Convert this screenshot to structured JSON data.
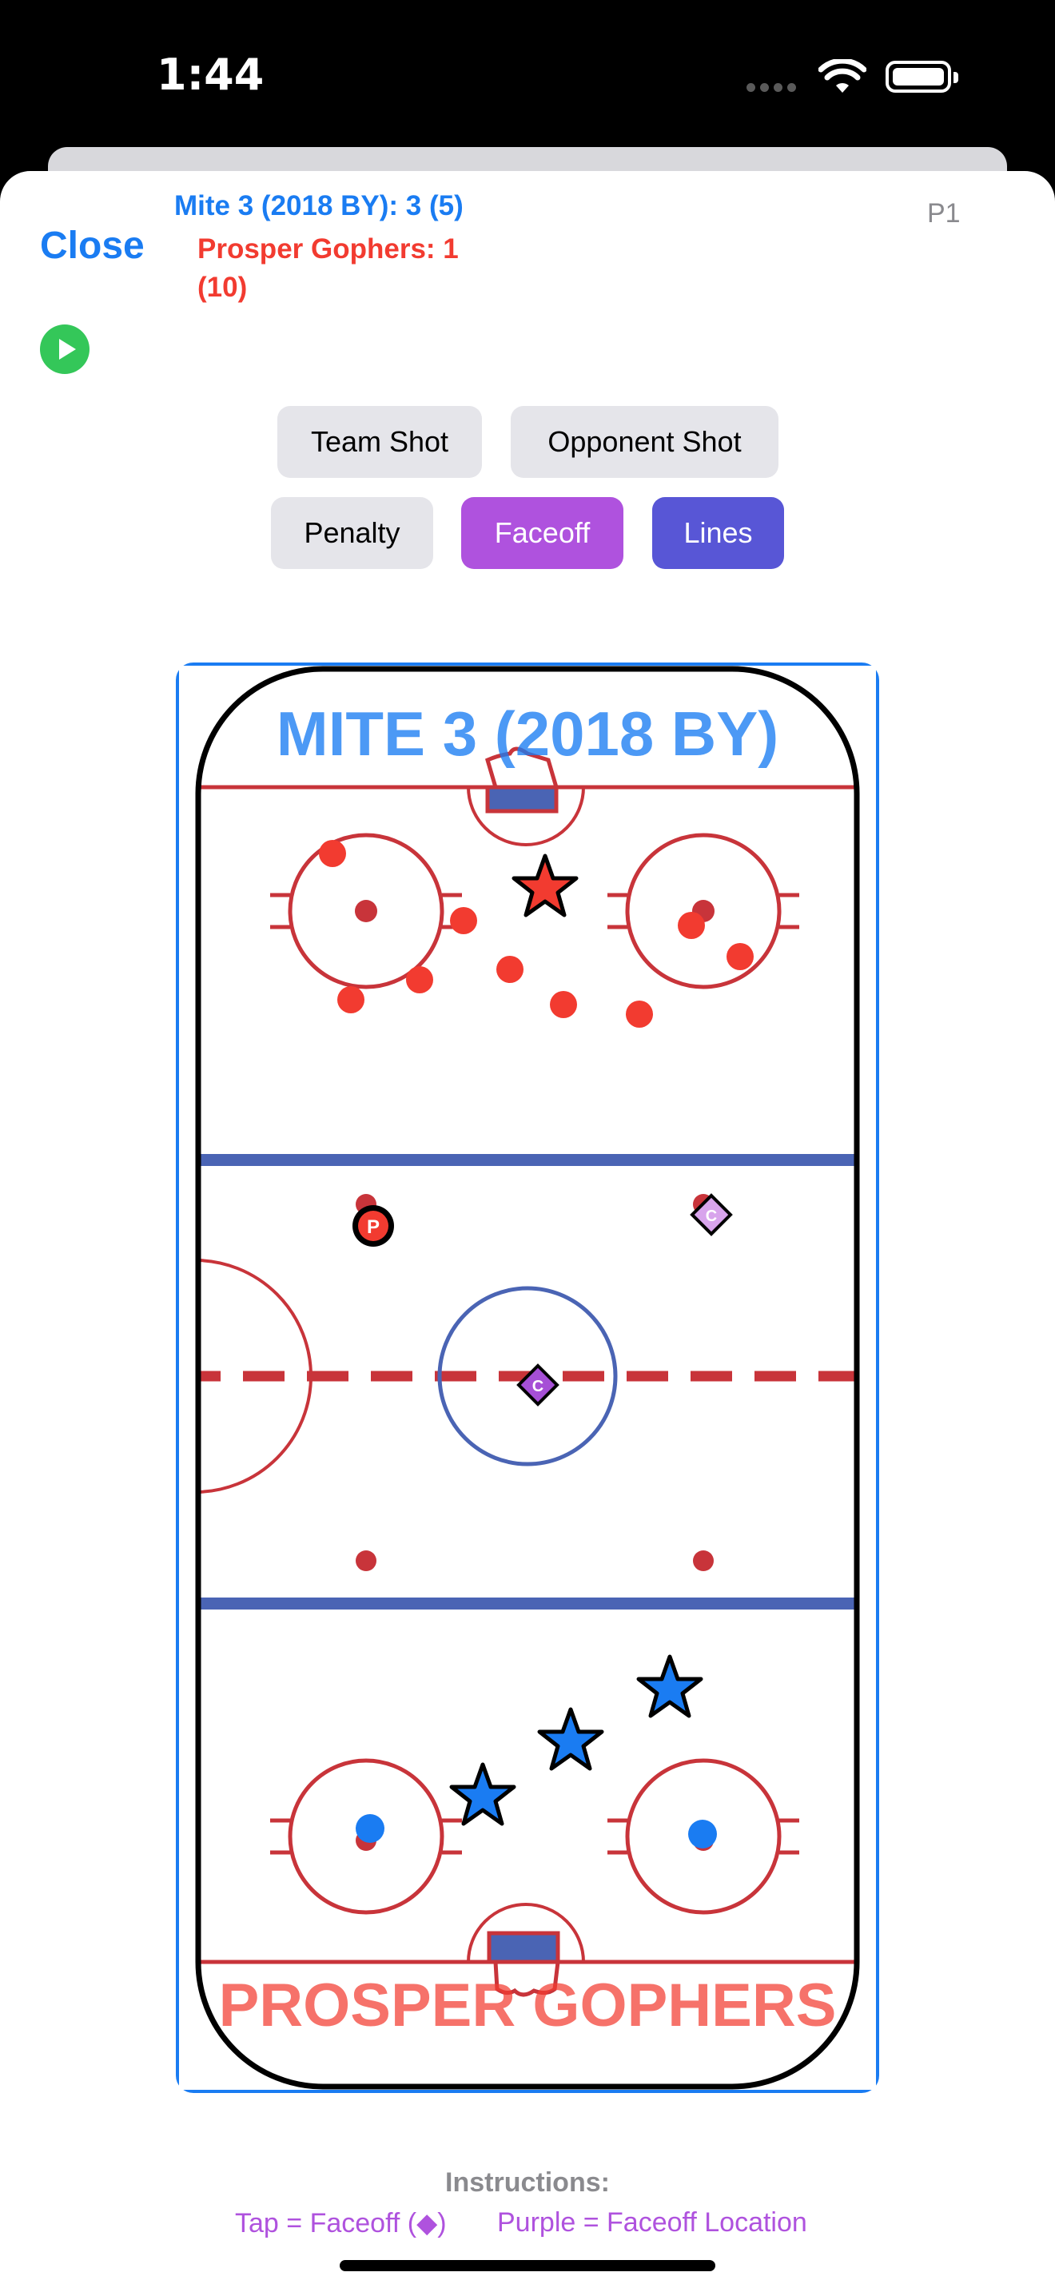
{
  "status_bar": {
    "time": "1:44"
  },
  "header": {
    "close_label": "Close",
    "team_score": "Mite 3 (2018 BY): 3 (5)",
    "opponent_score": "Prosper Gophers: 1 (10)",
    "period": "P1"
  },
  "actions": {
    "team_shot": "Team Shot",
    "opponent_shot": "Opponent Shot",
    "penalty": "Penalty",
    "faceoff": "Faceoff",
    "lines": "Lines"
  },
  "rink": {
    "team_name": "MITE 3 (2018 BY)",
    "opponent_name": "PROSPER GOPHERS",
    "penalty_marker": "P",
    "faceoff_marker": "C"
  },
  "instructions": {
    "heading": "Instructions:",
    "tap_hint": "Tap = Faceoff (◆)",
    "purple_hint": "Purple = Faceoff Location"
  },
  "colors": {
    "accent_blue": "#1A7CF2",
    "opponent_red": "#F23B30",
    "faceoff_purple": "#AF52DE",
    "lines_indigo": "#5856D6"
  },
  "icons": [
    "play-icon",
    "wifi-icon",
    "battery-icon",
    "star-icon",
    "diamond-icon"
  ]
}
